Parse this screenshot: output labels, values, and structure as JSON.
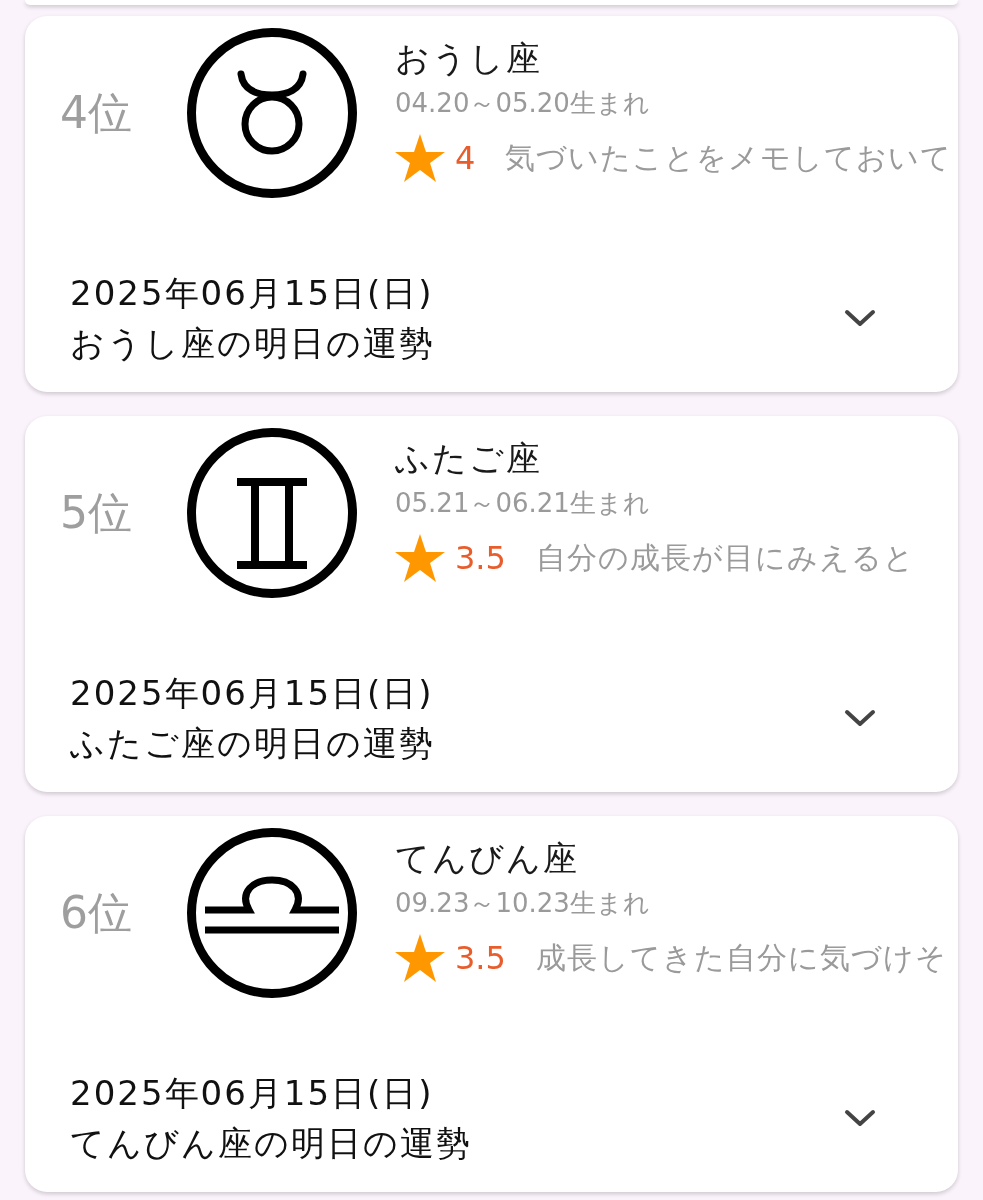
{
  "cards": [
    {
      "rank": "4位",
      "kind": "taurus",
      "name": "おうし座",
      "birth_range": "04.20～05.20生まれ",
      "score": "4",
      "message": "気づいたことをメモしておいて",
      "date": "2025年06月15日(日)",
      "title": "おうし座の明日の運勢",
      "expanded": false
    },
    {
      "rank": "5位",
      "kind": "gemini",
      "name": "ふたご座",
      "birth_range": "05.21～06.21生まれ",
      "score": "3.5",
      "message": "自分の成長が目にみえると",
      "date": "2025年06月15日(日)",
      "title": "ふたご座の明日の運勢",
      "expanded": false
    },
    {
      "rank": "6位",
      "kind": "libra",
      "name": "てんびん座",
      "birth_range": "09.23～10.23生まれ",
      "score": "3.5",
      "message": "成長してきた自分に気づけそ",
      "date": "2025年06月15日(日)",
      "title": "てんびん座の明日の運勢",
      "expanded": false
    }
  ]
}
